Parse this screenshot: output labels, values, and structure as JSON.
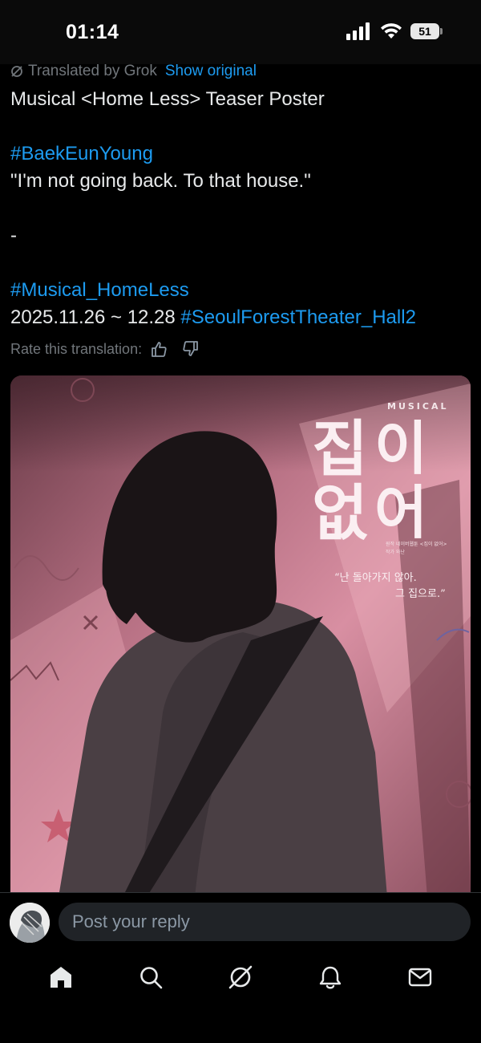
{
  "status": {
    "time": "01:14",
    "battery": "51"
  },
  "post": {
    "translated_by": "Translated by Grok",
    "show_original": "Show original",
    "title_line": "Musical <Home Less> Teaser Poster",
    "hashtag_actor": "#BaekEunYoung",
    "quote": "\"I'm not going back. To that house.\"",
    "dash": "-",
    "hashtag_musical": "#Musical_HomeLess",
    "dates": "2025.11.26 ~ 12.28",
    "hashtag_venue": "#SeoulForestTheater_Hall2",
    "rate_label": "Rate this translation:"
  },
  "poster": {
    "musical_label": "MUSICAL",
    "title_line1_a": "집",
    "title_line1_b": "이",
    "title_line2_a": "없",
    "title_line2_b": "어",
    "credit_line1": "원작 네이버웹툰 <집이 없어>",
    "credit_line2": "작가 와난",
    "quote_line1": "“난 돌아가지 않아.",
    "quote_line2": "그 집으로.”"
  },
  "reply": {
    "placeholder": "Post your reply"
  },
  "nav": {
    "icons": [
      "home-icon",
      "search-icon",
      "grok-icon",
      "notifications-icon",
      "messages-icon"
    ]
  },
  "colors": {
    "background": "#000000",
    "accent": "#1d9bf0",
    "muted": "#71767b",
    "poster_pink": "#d98a9d"
  }
}
